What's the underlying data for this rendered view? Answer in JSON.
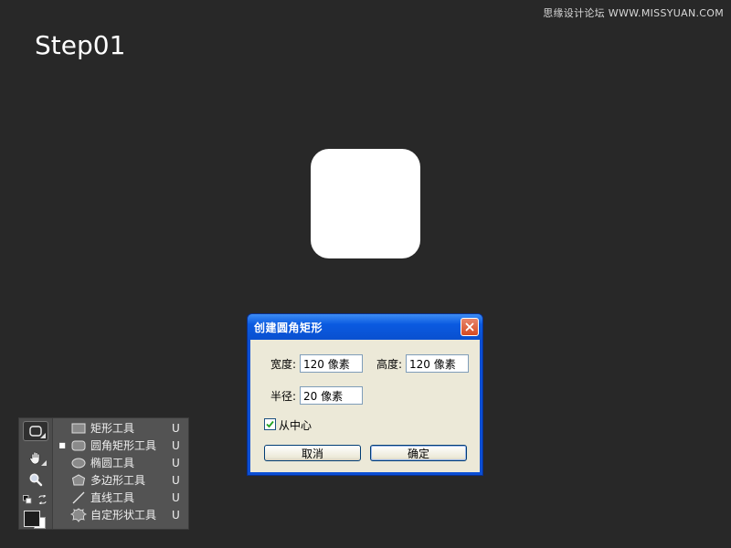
{
  "watermark": "思缘设计论坛 WWW.MISSYUAN.COM",
  "step_title": "Step01",
  "dialog": {
    "title": "创建圆角矩形",
    "width_label": "宽度:",
    "width_value": "120 像素",
    "height_label": "高度:",
    "height_value": "120 像素",
    "radius_label": "半径:",
    "radius_value": "20 像素",
    "from_center_label": "从中心",
    "from_center_checked": true,
    "cancel_label": "取消",
    "ok_label": "确定"
  },
  "tool_menu": {
    "items": [
      {
        "icon": "rectangle-icon",
        "label": "矩形工具",
        "key": "U",
        "selected": false
      },
      {
        "icon": "rounded-rectangle-icon",
        "label": "圆角矩形工具",
        "key": "U",
        "selected": true
      },
      {
        "icon": "ellipse-icon",
        "label": "椭圆工具",
        "key": "U",
        "selected": false
      },
      {
        "icon": "polygon-icon",
        "label": "多边形工具",
        "key": "U",
        "selected": false
      },
      {
        "icon": "line-icon",
        "label": "直线工具",
        "key": "U",
        "selected": false
      },
      {
        "icon": "custom-shape-icon",
        "label": "自定形状工具",
        "key": "U",
        "selected": false
      }
    ]
  },
  "colors": {
    "background": "#282828",
    "shape_fill": "#ffffff",
    "dialog_title_blue": "#0a5ae0",
    "close_red": "#d64a22"
  }
}
